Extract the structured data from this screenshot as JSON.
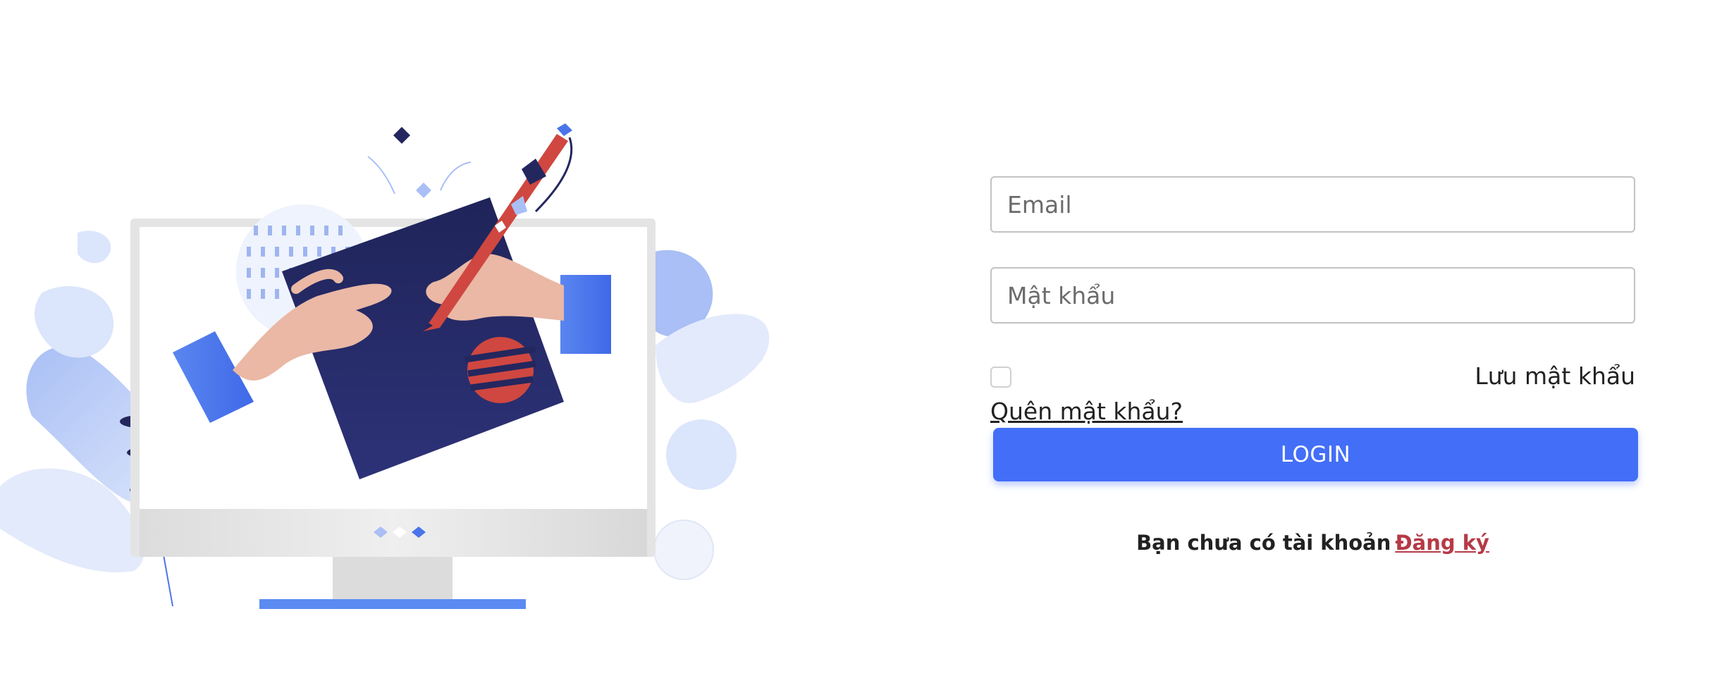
{
  "login_form": {
    "email_placeholder": "Email",
    "password_placeholder": "Mật khẩu",
    "remember_label": "Lưu mật khẩu",
    "forgot_password": "Quên mật khẩu?",
    "login_button": "LOGIN",
    "signup_prompt": "Bạn chưa có tài khoản",
    "signup_link": "Đăng ký"
  },
  "colors": {
    "primary_button": "#436ef7",
    "signup_link": "#b53a46",
    "illustration_navy": "#24275e",
    "illustration_blue": "#4a74ea",
    "illustration_red": "#cf4740"
  },
  "illustration": {
    "subject": "monitor with hands signing a document with a pen",
    "icons": [
      "monitor-icon",
      "pen-icon",
      "hand-icon",
      "leaf-icon"
    ]
  }
}
